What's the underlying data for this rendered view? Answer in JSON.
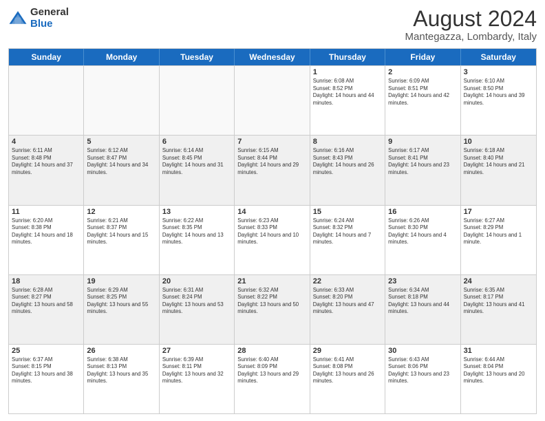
{
  "logo": {
    "general": "General",
    "blue": "Blue"
  },
  "title": "August 2024",
  "subtitle": "Mantegazza, Lombardy, Italy",
  "weekdays": [
    "Sunday",
    "Monday",
    "Tuesday",
    "Wednesday",
    "Thursday",
    "Friday",
    "Saturday"
  ],
  "rows": [
    [
      {
        "day": "",
        "info": ""
      },
      {
        "day": "",
        "info": ""
      },
      {
        "day": "",
        "info": ""
      },
      {
        "day": "",
        "info": ""
      },
      {
        "day": "1",
        "info": "Sunrise: 6:08 AM\nSunset: 8:52 PM\nDaylight: 14 hours and 44 minutes."
      },
      {
        "day": "2",
        "info": "Sunrise: 6:09 AM\nSunset: 8:51 PM\nDaylight: 14 hours and 42 minutes."
      },
      {
        "day": "3",
        "info": "Sunrise: 6:10 AM\nSunset: 8:50 PM\nDaylight: 14 hours and 39 minutes."
      }
    ],
    [
      {
        "day": "4",
        "info": "Sunrise: 6:11 AM\nSunset: 8:48 PM\nDaylight: 14 hours and 37 minutes."
      },
      {
        "day": "5",
        "info": "Sunrise: 6:12 AM\nSunset: 8:47 PM\nDaylight: 14 hours and 34 minutes."
      },
      {
        "day": "6",
        "info": "Sunrise: 6:14 AM\nSunset: 8:45 PM\nDaylight: 14 hours and 31 minutes."
      },
      {
        "day": "7",
        "info": "Sunrise: 6:15 AM\nSunset: 8:44 PM\nDaylight: 14 hours and 29 minutes."
      },
      {
        "day": "8",
        "info": "Sunrise: 6:16 AM\nSunset: 8:43 PM\nDaylight: 14 hours and 26 minutes."
      },
      {
        "day": "9",
        "info": "Sunrise: 6:17 AM\nSunset: 8:41 PM\nDaylight: 14 hours and 23 minutes."
      },
      {
        "day": "10",
        "info": "Sunrise: 6:18 AM\nSunset: 8:40 PM\nDaylight: 14 hours and 21 minutes."
      }
    ],
    [
      {
        "day": "11",
        "info": "Sunrise: 6:20 AM\nSunset: 8:38 PM\nDaylight: 14 hours and 18 minutes."
      },
      {
        "day": "12",
        "info": "Sunrise: 6:21 AM\nSunset: 8:37 PM\nDaylight: 14 hours and 15 minutes."
      },
      {
        "day": "13",
        "info": "Sunrise: 6:22 AM\nSunset: 8:35 PM\nDaylight: 14 hours and 13 minutes."
      },
      {
        "day": "14",
        "info": "Sunrise: 6:23 AM\nSunset: 8:33 PM\nDaylight: 14 hours and 10 minutes."
      },
      {
        "day": "15",
        "info": "Sunrise: 6:24 AM\nSunset: 8:32 PM\nDaylight: 14 hours and 7 minutes."
      },
      {
        "day": "16",
        "info": "Sunrise: 6:26 AM\nSunset: 8:30 PM\nDaylight: 14 hours and 4 minutes."
      },
      {
        "day": "17",
        "info": "Sunrise: 6:27 AM\nSunset: 8:29 PM\nDaylight: 14 hours and 1 minute."
      }
    ],
    [
      {
        "day": "18",
        "info": "Sunrise: 6:28 AM\nSunset: 8:27 PM\nDaylight: 13 hours and 58 minutes."
      },
      {
        "day": "19",
        "info": "Sunrise: 6:29 AM\nSunset: 8:25 PM\nDaylight: 13 hours and 55 minutes."
      },
      {
        "day": "20",
        "info": "Sunrise: 6:31 AM\nSunset: 8:24 PM\nDaylight: 13 hours and 53 minutes."
      },
      {
        "day": "21",
        "info": "Sunrise: 6:32 AM\nSunset: 8:22 PM\nDaylight: 13 hours and 50 minutes."
      },
      {
        "day": "22",
        "info": "Sunrise: 6:33 AM\nSunset: 8:20 PM\nDaylight: 13 hours and 47 minutes."
      },
      {
        "day": "23",
        "info": "Sunrise: 6:34 AM\nSunset: 8:18 PM\nDaylight: 13 hours and 44 minutes."
      },
      {
        "day": "24",
        "info": "Sunrise: 6:35 AM\nSunset: 8:17 PM\nDaylight: 13 hours and 41 minutes."
      }
    ],
    [
      {
        "day": "25",
        "info": "Sunrise: 6:37 AM\nSunset: 8:15 PM\nDaylight: 13 hours and 38 minutes."
      },
      {
        "day": "26",
        "info": "Sunrise: 6:38 AM\nSunset: 8:13 PM\nDaylight: 13 hours and 35 minutes."
      },
      {
        "day": "27",
        "info": "Sunrise: 6:39 AM\nSunset: 8:11 PM\nDaylight: 13 hours and 32 minutes."
      },
      {
        "day": "28",
        "info": "Sunrise: 6:40 AM\nSunset: 8:09 PM\nDaylight: 13 hours and 29 minutes."
      },
      {
        "day": "29",
        "info": "Sunrise: 6:41 AM\nSunset: 8:08 PM\nDaylight: 13 hours and 26 minutes."
      },
      {
        "day": "30",
        "info": "Sunrise: 6:43 AM\nSunset: 8:06 PM\nDaylight: 13 hours and 23 minutes."
      },
      {
        "day": "31",
        "info": "Sunrise: 6:44 AM\nSunset: 8:04 PM\nDaylight: 13 hours and 20 minutes."
      }
    ]
  ]
}
